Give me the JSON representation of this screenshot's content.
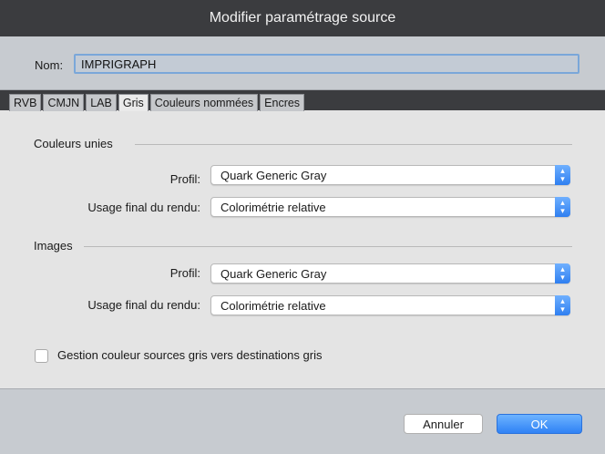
{
  "window": {
    "title": "Modifier paramétrage source"
  },
  "name_field": {
    "label": "Nom:",
    "value": "IMPRIGRAPH"
  },
  "tabs": [
    {
      "label": "RVB",
      "active": false
    },
    {
      "label": "CMJN",
      "active": false
    },
    {
      "label": "LAB",
      "active": false
    },
    {
      "label": "Gris",
      "active": true
    },
    {
      "label": "Couleurs nommées",
      "active": false
    },
    {
      "label": "Encres",
      "active": false
    }
  ],
  "solid_colors": {
    "title": "Couleurs unies",
    "profile_label": "Profil:",
    "profile_value": "Quark Generic Gray",
    "rendering_label": "Usage final du rendu:",
    "rendering_value": "Colorimétrie relative"
  },
  "images": {
    "title": "Images",
    "profile_label": "Profil:",
    "profile_value": "Quark Generic Gray",
    "rendering_label": "Usage final du rendu:",
    "rendering_value": "Colorimétrie relative"
  },
  "gray_management": {
    "label": "Gestion couleur sources gris vers destinations gris",
    "checked": false
  },
  "buttons": {
    "cancel": "Annuler",
    "ok": "OK"
  },
  "colors": {
    "accent": "#2f82f5",
    "titlebar": "#3b3c3f"
  }
}
